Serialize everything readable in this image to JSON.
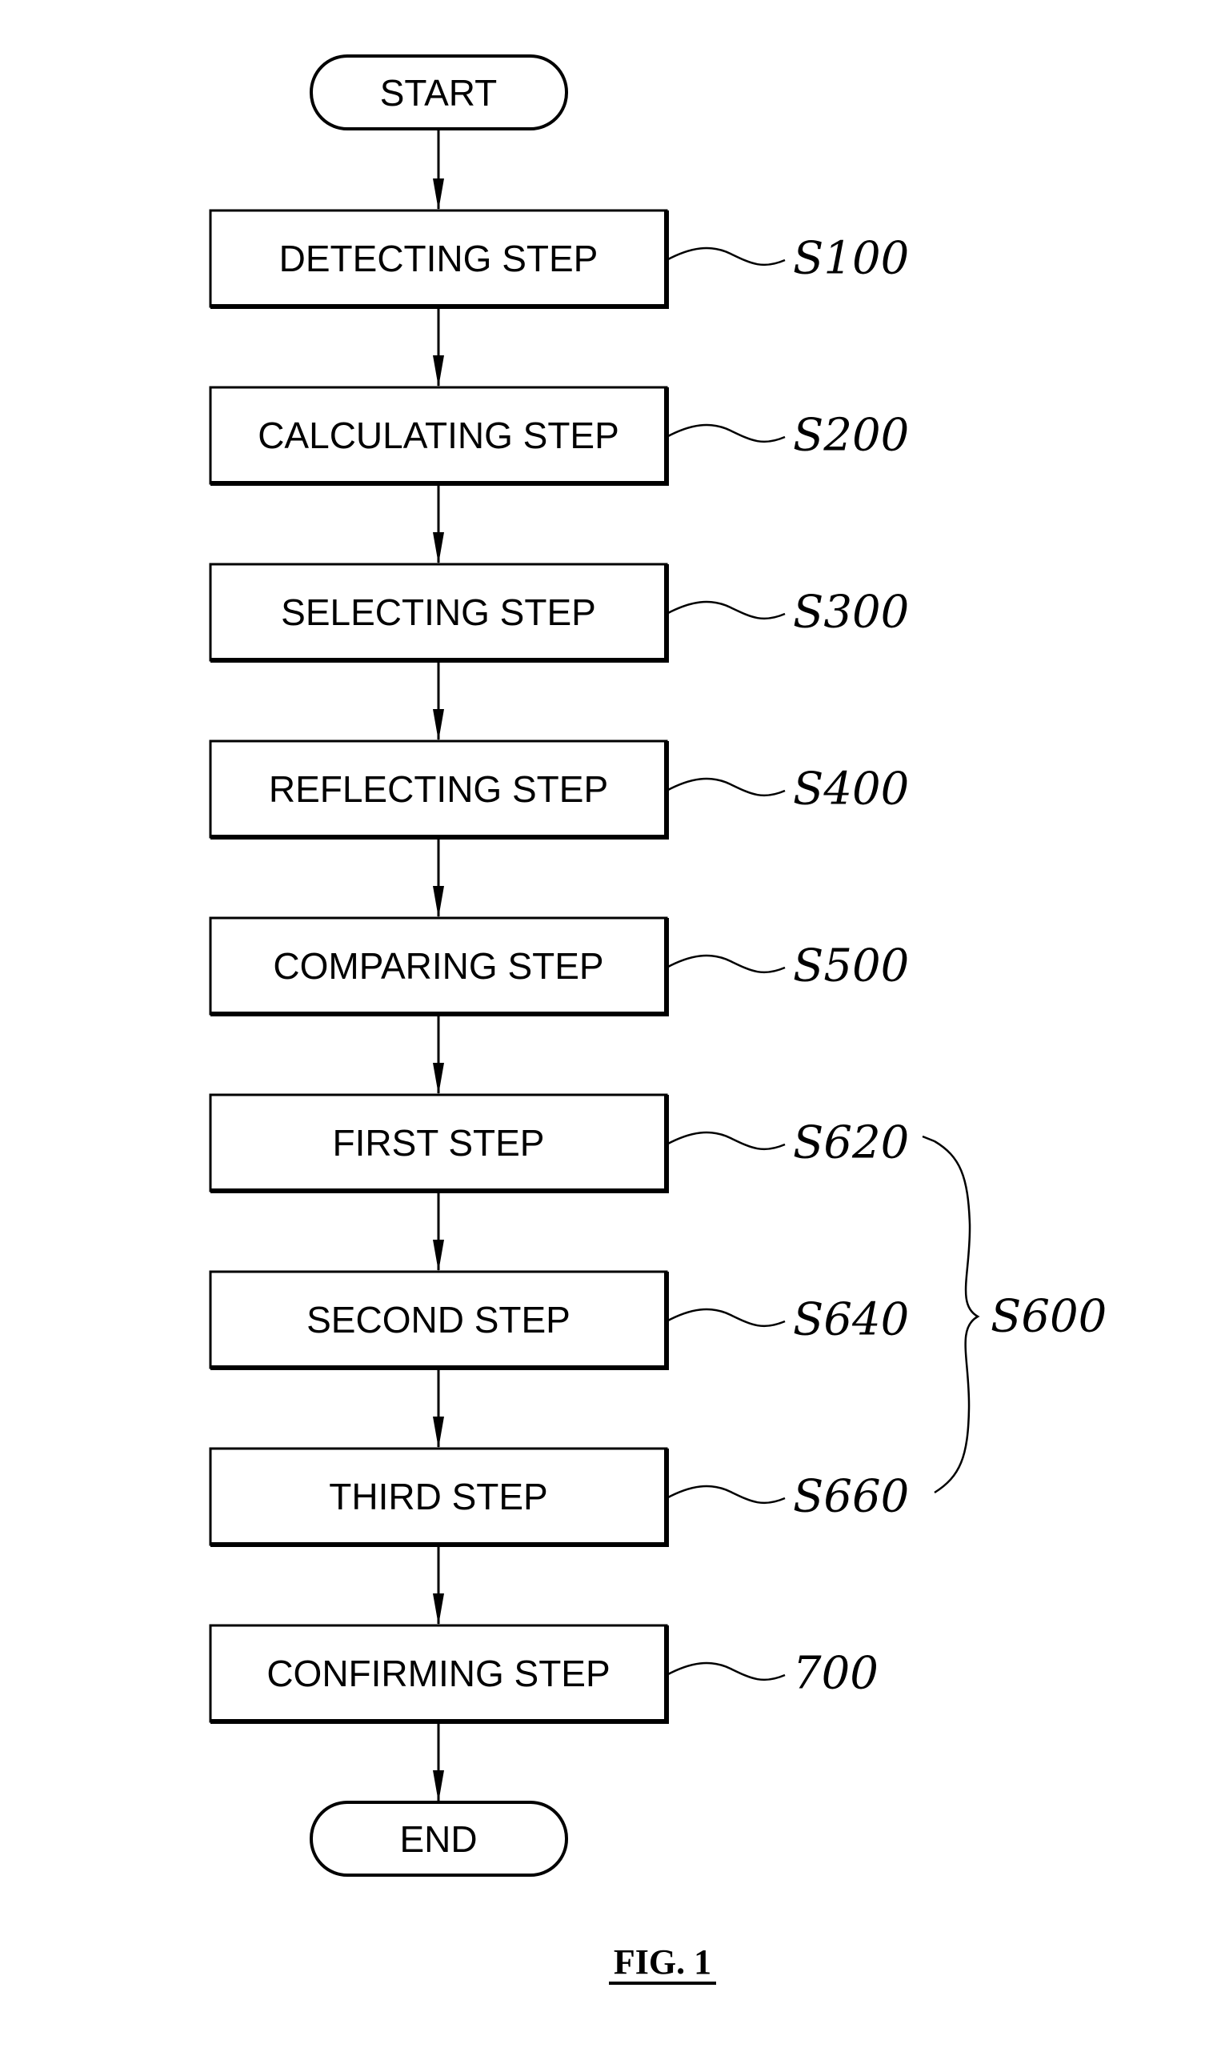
{
  "figure": {
    "caption": "FIG. 1",
    "start_label": "START",
    "end_label": "END",
    "steps": [
      {
        "label": "DETECTING STEP",
        "ref": "S100"
      },
      {
        "label": "CALCULATING STEP",
        "ref": "S200"
      },
      {
        "label": "SELECTING STEP",
        "ref": "S300"
      },
      {
        "label": "REFLECTING STEP",
        "ref": "S400"
      },
      {
        "label": "COMPARING STEP",
        "ref": "S500"
      },
      {
        "label": "FIRST STEP",
        "ref": "S620"
      },
      {
        "label": "SECOND STEP",
        "ref": "S640"
      },
      {
        "label": "THIRD STEP",
        "ref": "S660"
      },
      {
        "label": "CONFIRMING STEP",
        "ref": "700"
      }
    ],
    "group": {
      "ref": "S600",
      "members": [
        "S620",
        "S640",
        "S660"
      ]
    }
  }
}
